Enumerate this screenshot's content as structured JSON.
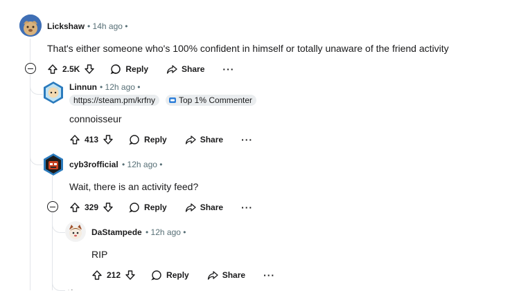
{
  "comments": [
    {
      "username": "Lickshaw",
      "time": "14h ago",
      "body": "That's either someone who's 100% confident in himself or totally unaware of the friend activity",
      "votes": "2.5K",
      "reply_label": "Reply",
      "share_label": "Share"
    },
    {
      "username": "Linnun",
      "time": "12h ago",
      "flair_link": "https://steam.pm/krfny",
      "flair_badge": "Top 1% Commenter",
      "body": "connoisseur",
      "votes": "413",
      "reply_label": "Reply",
      "share_label": "Share"
    },
    {
      "username": "cyb3rofficial",
      "time": "12h ago",
      "body": "Wait, there is an activity feed?",
      "votes": "329",
      "reply_label": "Reply",
      "share_label": "Share"
    },
    {
      "username": "DaStampede",
      "time": "12h ago",
      "body": "RIP",
      "votes": "212",
      "reply_label": "Reply",
      "share_label": "Share"
    }
  ],
  "separator": "•",
  "icons": [
    "upvote-icon",
    "downvote-icon",
    "reply-icon",
    "share-icon",
    "more-icon",
    "collapse-icon"
  ],
  "colors": {
    "meta": "#576f76",
    "thread_line": "#e2e5e9",
    "text": "#1a1a1b",
    "flair_bg": "#eaedef"
  }
}
